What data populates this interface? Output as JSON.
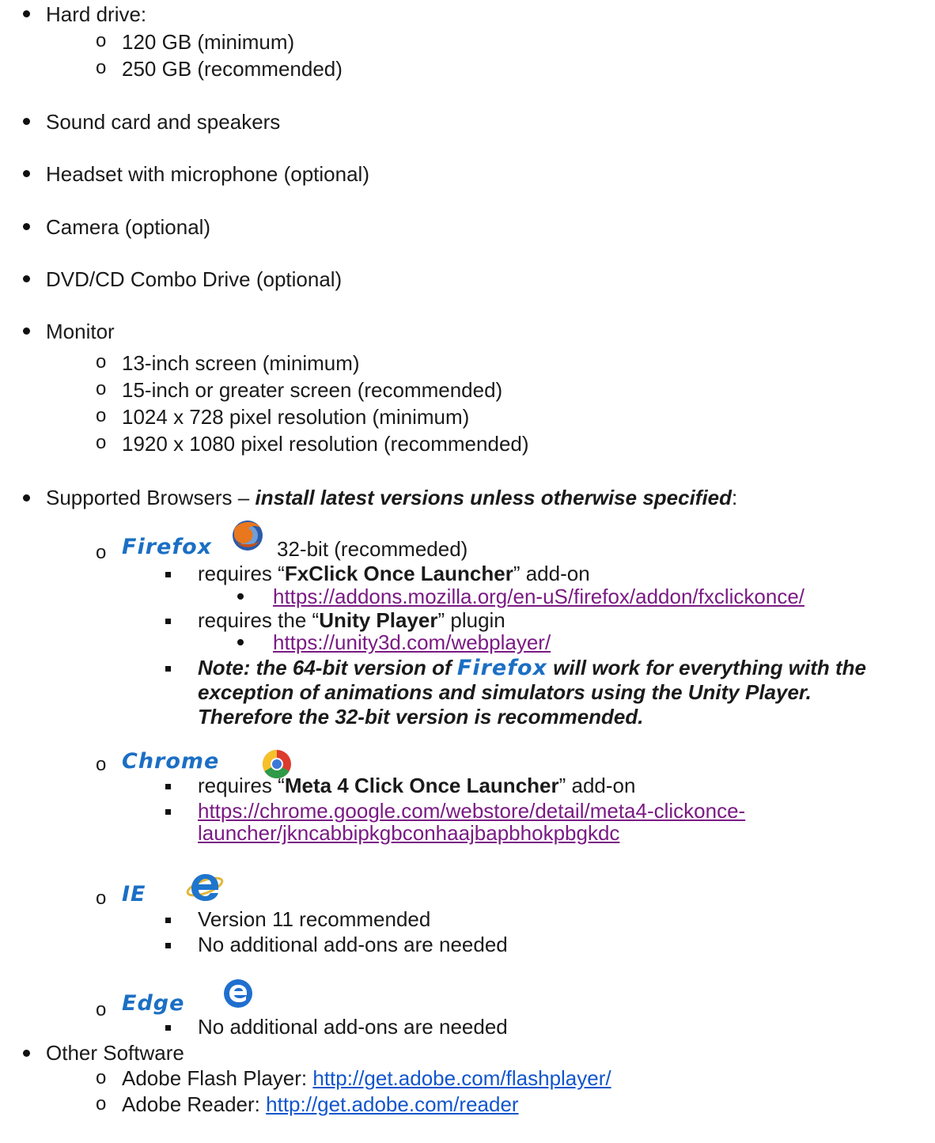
{
  "items": {
    "hard_drive": "Hard drive:",
    "hd_min": "120 GB (minimum)",
    "hd_rec": "250 GB (recommended)",
    "sound": "Sound card and speakers",
    "headset": "Headset with microphone (optional)",
    "camera": "Camera (optional)",
    "dvd": "DVD/CD Combo Drive (optional)",
    "monitor": "Monitor",
    "mon_1": "13-inch screen (minimum)",
    "mon_2": "15-inch or greater screen (recommended)",
    "mon_3": "1024 x 728 pixel resolution (minimum)",
    "mon_4": "1920 x 1080 pixel resolution (recommended)"
  },
  "browsers": {
    "heading_prefix": "Supported Browsers – ",
    "heading_emph": "install latest versions unless otherwise specified",
    "heading_suffix": ":",
    "firefox": {
      "name": "Firefox",
      "desc": "32-bit (recommeded)",
      "req1_pre": "requires “",
      "req1_bold": "FxClick Once Launcher",
      "req1_post": "” add-on",
      "link1": "https://addons.mozilla.org/en-uS/firefox/addon/fxclickonce/",
      "req2_pre": "requires the “",
      "req2_bold": "Unity Player",
      "req2_post": "” plugin",
      "link2": "https://unity3d.com/webplayer/",
      "note_pre": "Note: the 64-bit version of ",
      "note_brand": "Firefox",
      "note_post": " will work for everything with the",
      "note_line2": "exception of animations and simulators using the Unity Player.",
      "note_line3": "Therefore the 32-bit version is recommended."
    },
    "chrome": {
      "name": "Chrome",
      "req_pre": "requires “",
      "req_bold": "Meta 4 Click Once Launcher",
      "req_post": "”  add-on",
      "link_line1": "https://chrome.google.com/webstore/detail/meta4-clickonce-",
      "link_line2": "launcher/jkncabbipkgbconhaajbapbhokpbgkdc"
    },
    "ie": {
      "name": "IE",
      "item1": "Version 11 recommended",
      "item2": "No additional add-ons are needed"
    },
    "edge": {
      "name": "Edge",
      "item1": "No additional add-ons are needed"
    }
  },
  "other": {
    "heading": "Other Software",
    "flash_label": "Adobe Flash Player:",
    "flash_link": "http://get.adobe.com/flashplayer/",
    "reader_label": "Adobe Reader:",
    "reader_link": "http://get.adobe.com/reader"
  },
  "icons": {
    "firefox": "firefox-icon",
    "chrome": "chrome-icon",
    "ie": "ie-icon",
    "edge": "edge-icon"
  }
}
